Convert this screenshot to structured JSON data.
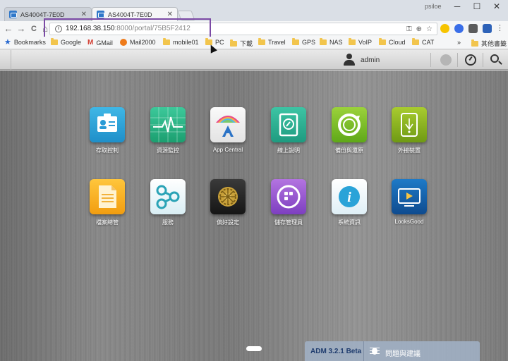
{
  "browser": {
    "tabs": [
      {
        "title": "AS4004T-7E0D",
        "active": false
      },
      {
        "title": "AS4004T-7E0D",
        "active": true
      }
    ],
    "window_user": "psiloe",
    "window_controls": {
      "minimize": "─",
      "maximize": "☐",
      "close": "✕"
    },
    "nav": {
      "back": "←",
      "forward": "→",
      "reload": "C",
      "home": "⌂"
    },
    "address": {
      "host": "192.168.38.150",
      "rest": ":8000/portal/75B5F2412"
    },
    "omnibox_icons": [
      "key-icon",
      "zoom-icon",
      "star-icon"
    ],
    "bookmarks": [
      {
        "label": "Bookmarks",
        "icon": "star-icon"
      },
      {
        "label": "Google",
        "icon": "folder-icon"
      },
      {
        "label": "GMail",
        "icon": "gmail-icon"
      },
      {
        "label": "Mail2000",
        "icon": "mail2000-icon"
      },
      {
        "label": "mobile01",
        "icon": "folder-icon"
      },
      {
        "label": "PC",
        "icon": "folder-icon"
      },
      {
        "label": "下載",
        "icon": "folder-icon"
      },
      {
        "label": "Travel",
        "icon": "folder-icon"
      },
      {
        "label": "GPS",
        "icon": "folder-icon"
      },
      {
        "label": "NAS",
        "icon": "folder-icon"
      },
      {
        "label": "VoIP",
        "icon": "folder-icon"
      },
      {
        "label": "Cloud",
        "icon": "folder-icon"
      },
      {
        "label": "CAT",
        "icon": "folder-icon"
      }
    ],
    "bookmarks_more": "»",
    "other_bookmarks": "其他書籤"
  },
  "adm": {
    "user": "admin",
    "apps": [
      {
        "label": "存取控制",
        "icon": "access-control-icon"
      },
      {
        "label": "資源監控",
        "icon": "activity-monitor-icon"
      },
      {
        "label": "App Central",
        "icon": "app-central-icon"
      },
      {
        "label": "線上說明",
        "icon": "online-help-icon"
      },
      {
        "label": "備份與還原",
        "icon": "backup-restore-icon"
      },
      {
        "label": "外接裝置",
        "icon": "external-devices-icon"
      },
      {
        "label": "檔案總管",
        "icon": "file-explorer-icon"
      },
      {
        "label": "服務",
        "icon": "services-icon"
      },
      {
        "label": "偏好設定",
        "icon": "preferences-icon"
      },
      {
        "label": "儲存管理員",
        "icon": "storage-manager-icon"
      },
      {
        "label": "系統資訊",
        "icon": "system-info-icon"
      },
      {
        "label": "LooksGood",
        "icon": "looksgood-icon"
      }
    ],
    "version": "ADM 3.2.1 Beta",
    "feedback": "問題與建議"
  }
}
